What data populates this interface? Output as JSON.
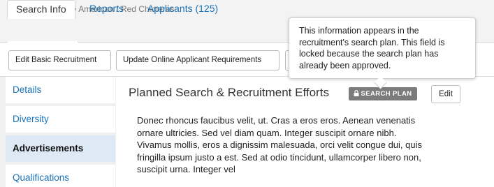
{
  "breadcrumb": "JPF00002 • Native American / Red Chimeras",
  "tabs": [
    {
      "label": "Search Info",
      "active": true
    },
    {
      "label": "Reports",
      "active": false
    },
    {
      "label": "Applicants (125)",
      "active": false
    }
  ],
  "toolbar": {
    "edit_basic_recruitment": "Edit Basic Recruitment",
    "update_online_requirements": "Update Online Applicant Requirements"
  },
  "sidebar": {
    "items": [
      {
        "label": "Details",
        "active": false
      },
      {
        "label": "Diversity",
        "active": false
      },
      {
        "label": "Advertisements",
        "active": true
      },
      {
        "label": "Qualifications",
        "active": false
      }
    ]
  },
  "section": {
    "title": "Planned Search & Recruitment Efforts",
    "badge": "SEARCH PLAN",
    "edit_label": "Edit",
    "body": "Donec rhoncus faucibus velit, ut. Cras a eros eros. Aenean venenatis ornare ultricies. Sed vel diam quam. Integer suscipit ornare nibh. Vivamus mollis, eros a dignissim malesuada, orci velit congue dui, quis fringilla ipsum justo a est. Sed at odio tincidunt, ullamcorper libero non, suscipit urna. Integer vel"
  },
  "tooltip": {
    "text": "This information appears in the recruitment's search plan. This field is locked because the search plan has already been approved."
  },
  "colors": {
    "link": "#1a73b8",
    "badge": "#7b7b7b",
    "active_sidebar": "#dde9f4"
  }
}
